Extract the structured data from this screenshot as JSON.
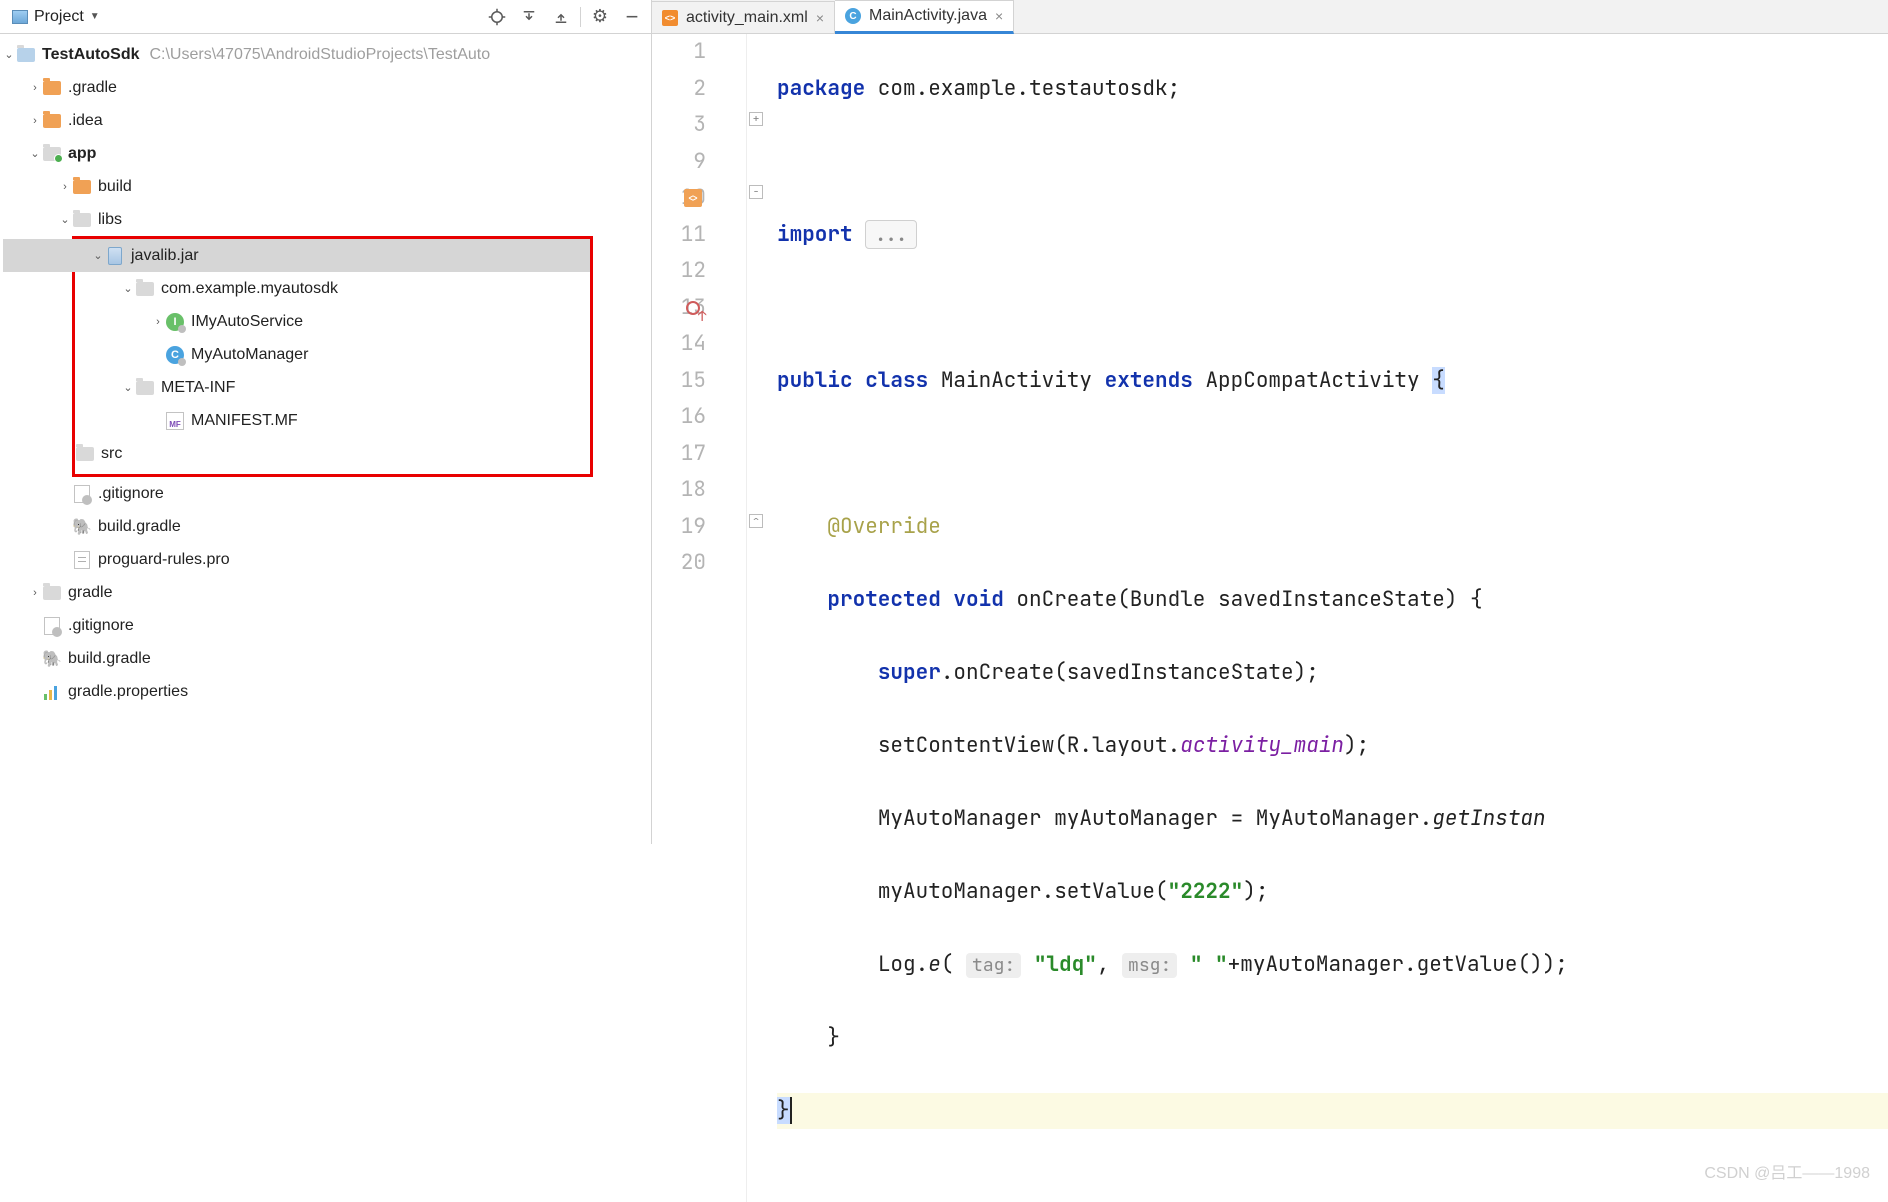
{
  "header": {
    "title": "Project"
  },
  "tree": {
    "root": {
      "name": "TestAutoSdk",
      "path": "C:\\Users\\47075\\AndroidStudioProjects\\TestAuto"
    },
    "items": {
      "gradleFolder": ".gradle",
      "idea": ".idea",
      "app": "app",
      "build": "build",
      "libs": "libs",
      "javalib": "javalib.jar",
      "pkg": "com.example.myautosdk",
      "iface": "IMyAutoService",
      "klass": "MyAutoManager",
      "metainf": "META-INF",
      "manifest": "MANIFEST.MF",
      "src": "src",
      "gitignore1": ".gitignore",
      "buildGradle1": "build.gradle",
      "proguard": "proguard-rules.pro",
      "gradle": "gradle",
      "gitignore2": ".gitignore",
      "buildGradle2": "build.gradle",
      "gradleProps": "gradle.properties"
    }
  },
  "tabs": [
    {
      "name": "activity_main.xml",
      "active": false
    },
    {
      "name": "MainActivity.java",
      "active": true
    }
  ],
  "code": {
    "lines": [
      "1",
      "2",
      "3",
      "9",
      "10",
      "11",
      "12",
      "13",
      "14",
      "15",
      "16",
      "17",
      "18",
      "19",
      "20"
    ],
    "package_kw": "package",
    "package_name": " com.example.testautosdk;",
    "import_kw": "import ",
    "folded": "...",
    "public_kw": "public ",
    "class_kw": "class ",
    "class_name": "MainActivity ",
    "extends_kw": "extends ",
    "super_name": "AppCompatActivity ",
    "brace_open": "{",
    "override": "@Override",
    "protected_kw": "protected ",
    "void_kw": "void ",
    "onCreate_sig": "onCreate(Bundle savedInstanceState) {",
    "super_call": "super",
    "super_rest": ".onCreate(savedInstanceState);",
    "setcv_a": "setContentView(R.layout.",
    "setcv_b": "activity_main",
    "setcv_c": ");",
    "mgr_a": "MyAutoManager myAutoManager = MyAutoManager.",
    "mgr_b": "getInstan",
    "setval_a": "myAutoManager.setValue(",
    "setval_b": "\"2222\"",
    "setval_c": ");",
    "log_a": "Log.",
    "log_e": "e",
    "log_b": "( ",
    "hint_tag": "tag:",
    "log_str1": " \"ldq\"",
    "log_c": ", ",
    "hint_msg": "msg:",
    "log_str2": " \" \"",
    "log_d": "+myAutoManager.getValue());",
    "brace_close1": "}",
    "brace_close2": "}"
  },
  "watermark": "CSDN @吕工——1998"
}
